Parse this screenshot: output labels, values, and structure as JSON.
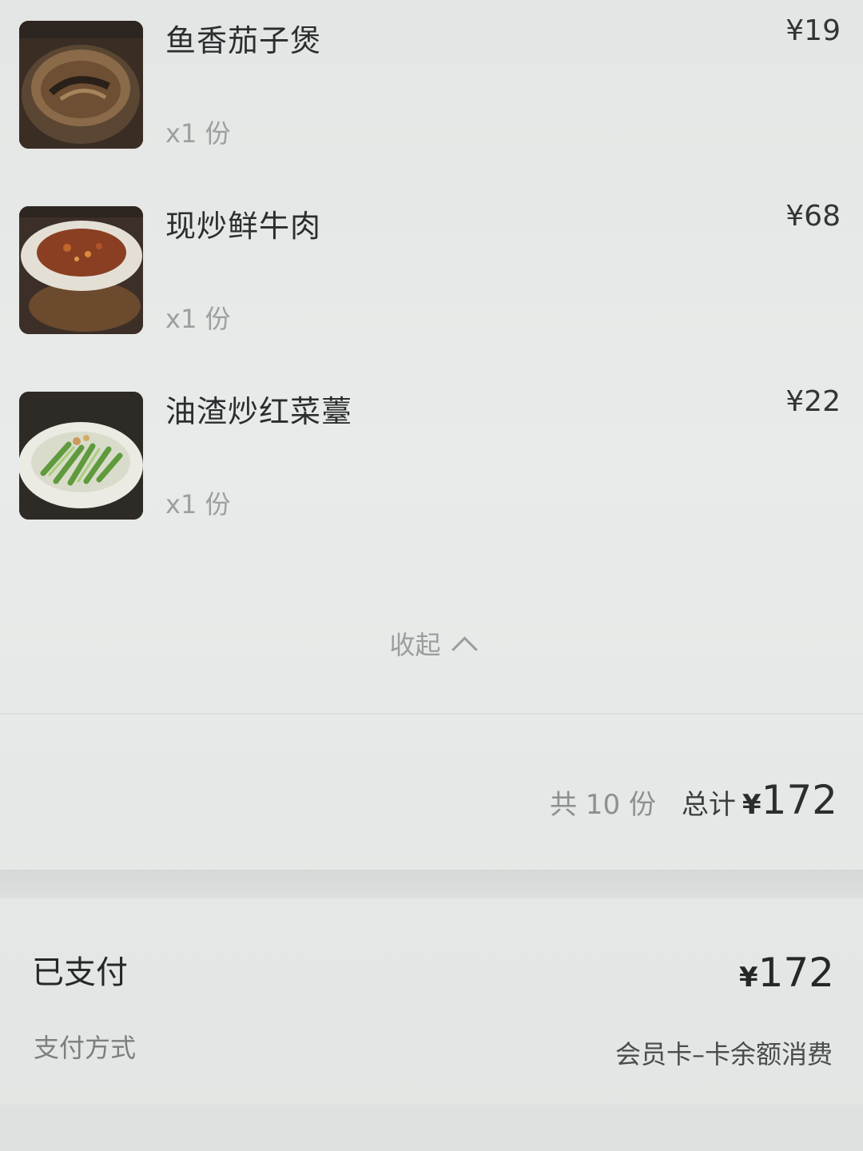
{
  "items": [
    {
      "name": "鱼香茄子煲",
      "qty": "x1 份",
      "price": "¥19",
      "image": "claypot-eggplant-photo"
    },
    {
      "name": "现炒鲜牛肉",
      "qty": "x1 份",
      "price": "¥68",
      "image": "stir-fried-beef-photo"
    },
    {
      "name": "油渣炒红菜薹",
      "qty": "x1 份",
      "price": "¥22",
      "image": "vegetable-stir-fry-photo"
    }
  ],
  "collapse": {
    "label": "收起",
    "icon": "chevron-up-icon"
  },
  "summary": {
    "count": "共 10 份",
    "total_label": "总计",
    "currency": "¥",
    "total_amount": "172"
  },
  "payment": {
    "status": "已支付",
    "currency": "¥",
    "amount": "172",
    "method_label": "支付方式",
    "method_value": "会员卡–卡余额消费"
  }
}
